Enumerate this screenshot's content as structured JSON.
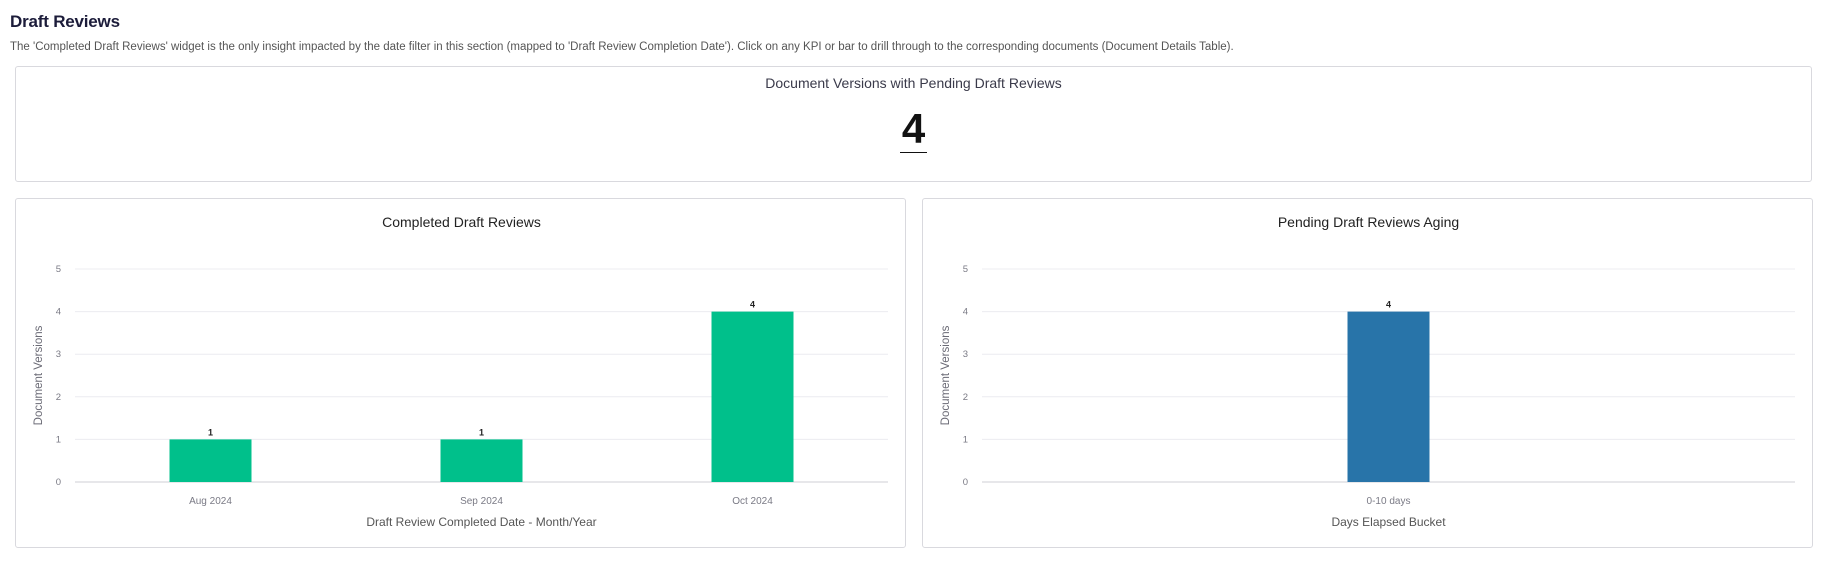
{
  "section": {
    "title": "Draft Reviews",
    "description": "The 'Completed Draft Reviews' widget is the only insight impacted by the date filter in this section (mapped to 'Draft Review Completion Date'). Click on any KPI or bar to drill through to the corresponding documents (Document Details Table)."
  },
  "kpi": {
    "title": "Document Versions with Pending Draft Reviews",
    "value": "4"
  },
  "chart_data": [
    {
      "type": "bar",
      "title": "Completed Draft Reviews",
      "xlabel": "Draft Review Completed Date - Month/Year",
      "ylabel": "Document Versions",
      "categories": [
        "Aug 2024",
        "Sep 2024",
        "Oct 2024"
      ],
      "values": [
        1,
        1,
        4
      ],
      "ylim": [
        0,
        5
      ],
      "yticks": [
        0,
        1,
        2,
        3,
        4,
        5
      ],
      "color": "#00c08b",
      "grid": true
    },
    {
      "type": "bar",
      "title": "Pending Draft Reviews Aging",
      "xlabel": "Days Elapsed Bucket",
      "ylabel": "Document Versions",
      "categories": [
        "0-10 days"
      ],
      "values": [
        4
      ],
      "ylim": [
        0,
        5
      ],
      "yticks": [
        0,
        1,
        2,
        3,
        4,
        5
      ],
      "color": "#2874a9",
      "grid": true
    }
  ]
}
